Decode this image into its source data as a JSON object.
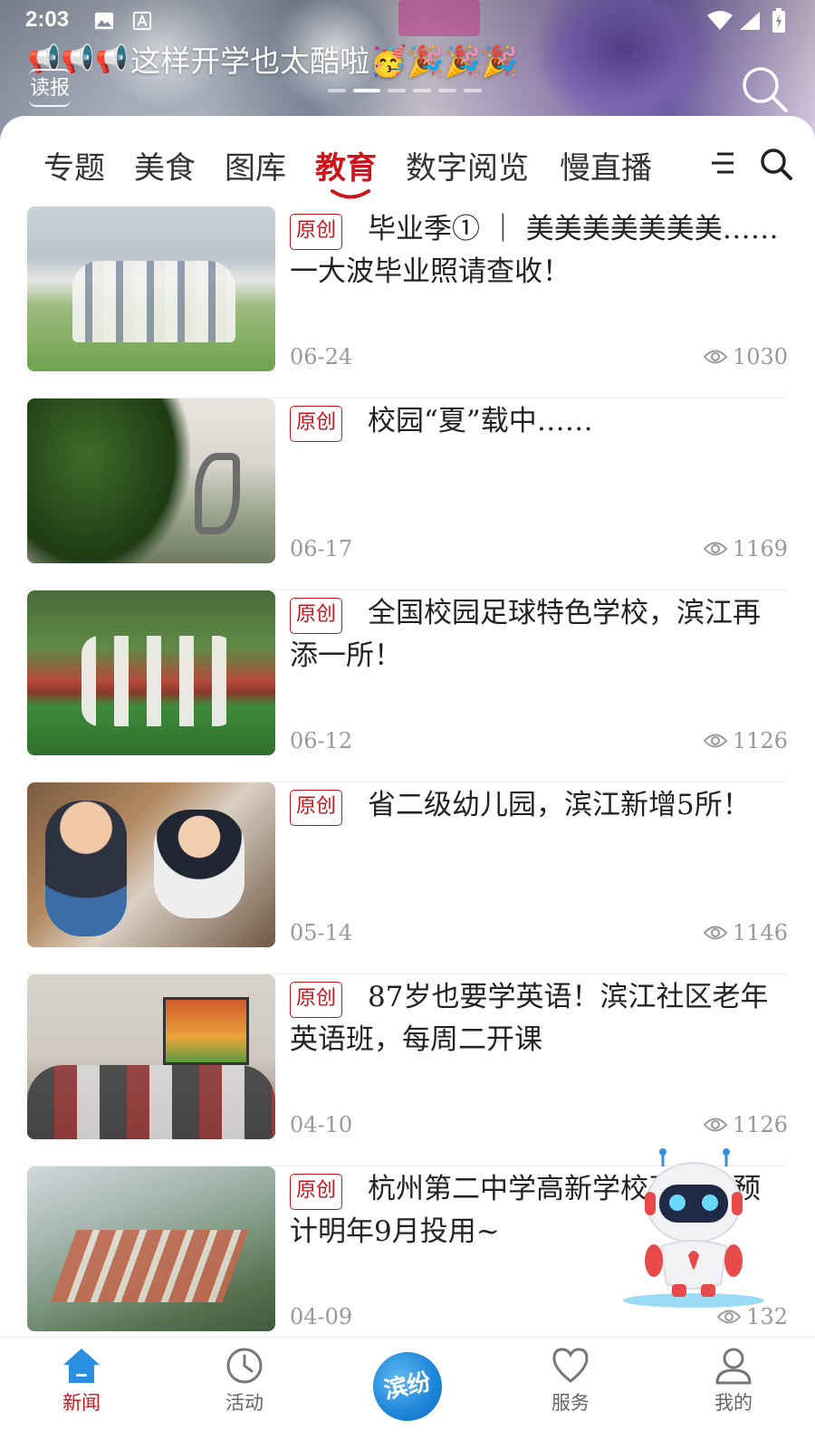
{
  "status_bar": {
    "time": "2:03"
  },
  "banner": {
    "headline": "这样开学也太酷啦🥳🎉🎉🎉",
    "horn_icons": "📢📢📢",
    "read_label": "读报"
  },
  "tabs": [
    {
      "label": "专题"
    },
    {
      "label": "美食"
    },
    {
      "label": "图库"
    },
    {
      "label": "教育",
      "active": true
    },
    {
      "label": "数字阅览"
    },
    {
      "label": "慢直播"
    }
  ],
  "news": [
    {
      "tag": "原创",
      "title": "毕业季① ｜ 美美美美美美美……一大波毕业照请查收！",
      "date": "06-24",
      "views": "1030"
    },
    {
      "tag": "原创",
      "title": "校园“夏”载中……",
      "date": "06-17",
      "views": "1169"
    },
    {
      "tag": "原创",
      "title": "全国校园足球特色学校，滨江再添一所！",
      "date": "06-12",
      "views": "1126"
    },
    {
      "tag": "原创",
      "title": "省二级幼儿园，滨江新增5所！",
      "date": "05-14",
      "views": "1146"
    },
    {
      "tag": "原创",
      "title": "87岁也要学英语！滨江社区老年英语班，每周二开课",
      "date": "04-10",
      "views": "1126"
    },
    {
      "tag": "原创",
      "title": "杭州第二中学高新学校开工！预计明年9月投用~",
      "date": "04-09",
      "views": "132"
    }
  ],
  "bottom_nav": [
    {
      "label": "新闻",
      "icon": "home-icon",
      "active": true
    },
    {
      "label": "活动",
      "icon": "clock-icon"
    },
    {
      "label": "滨纷",
      "icon": "app-logo"
    },
    {
      "label": "服务",
      "icon": "heart-icon"
    },
    {
      "label": "我的",
      "icon": "person-icon"
    }
  ],
  "colors": {
    "accent": "#d0121b",
    "nav_active_icon": "#1d86d8",
    "muted": "#999999"
  }
}
